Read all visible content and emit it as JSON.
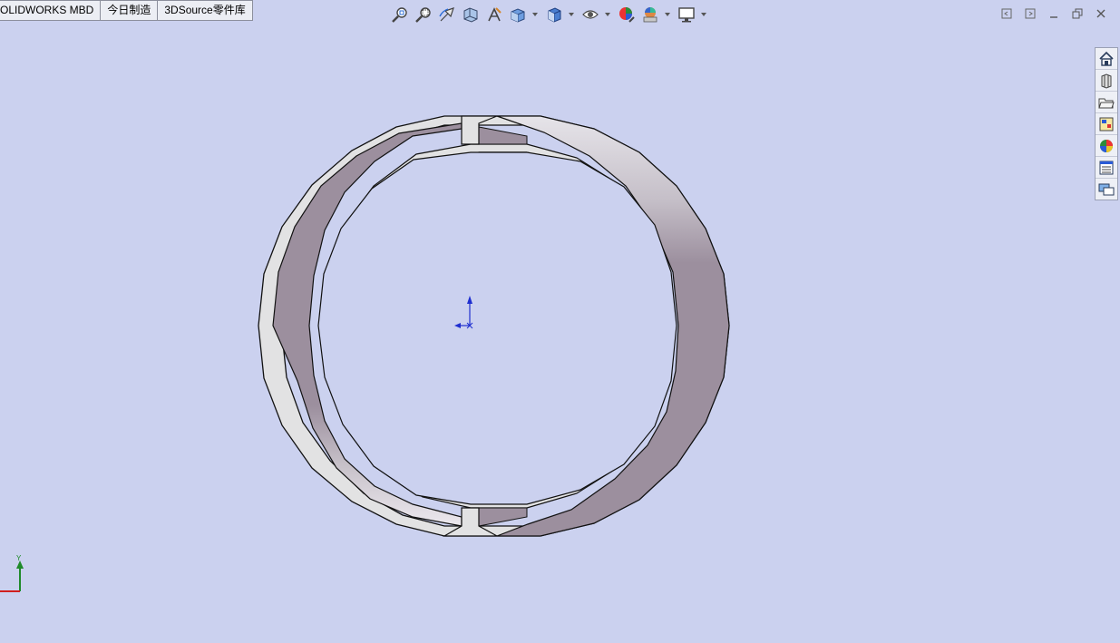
{
  "tabs": [
    {
      "label": "OLIDWORKS MBD"
    },
    {
      "label": "今日制造"
    },
    {
      "label": "3DSource零件库"
    }
  ],
  "triad": {
    "y_label": "Y"
  },
  "hud_icons": [
    "zoom-to-fit-icon",
    "zoom-to-area-icon",
    "previous-view-icon",
    "section-view-icon",
    "dynamic-annotation-icon",
    "view-orientation-icon",
    "display-style-icon",
    "hide-show-items-icon",
    "edit-appearance-icon",
    "apply-scene-icon",
    "view-settings-icon"
  ],
  "taskpane_icons": [
    "home-icon",
    "design-library-icon",
    "file-explorer-icon",
    "view-palette-icon",
    "appearances-icon",
    "custom-properties-icon",
    "forum-icon"
  ],
  "colors": {
    "background": "#cbd1ef",
    "part_light": "#e2e2e3",
    "part_shade": "#9c8f9e"
  }
}
